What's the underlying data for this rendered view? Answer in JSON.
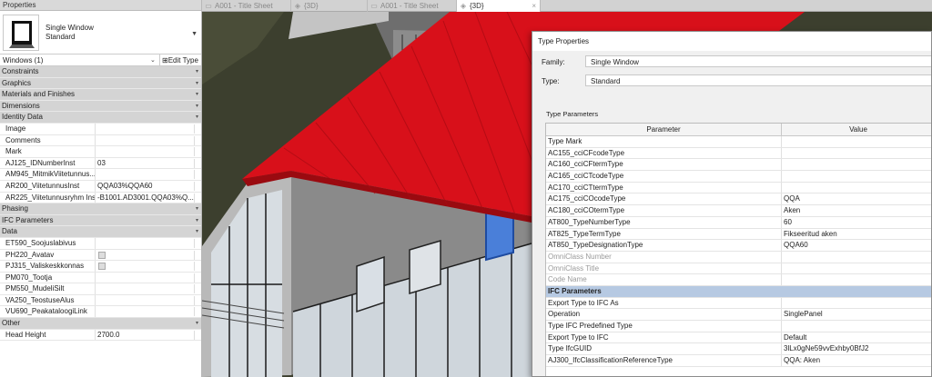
{
  "properties": {
    "panel_title": "Properties",
    "type_name": "Single Window",
    "type_subname": "Standard",
    "filter": "Windows (1)",
    "edit_type_label": "Edit Type",
    "rows": [
      {
        "kind": "section",
        "label": "Constraints"
      },
      {
        "kind": "section",
        "label": "Graphics"
      },
      {
        "kind": "section",
        "label": "Materials and Finishes"
      },
      {
        "kind": "section",
        "label": "Dimensions"
      },
      {
        "kind": "section",
        "label": "Identity Data"
      },
      {
        "kind": "prop",
        "label": "Image",
        "value": ""
      },
      {
        "kind": "prop",
        "label": "Comments",
        "value": ""
      },
      {
        "kind": "prop",
        "label": "Mark",
        "value": ""
      },
      {
        "kind": "prop",
        "label": "AJ125_IDNumberInst",
        "value": "03"
      },
      {
        "kind": "prop",
        "label": "AM945_MitmikViitetunnus...",
        "value": ""
      },
      {
        "kind": "prop",
        "label": "AR200_ViitetunnusInst",
        "value": "QQA03%QQA60"
      },
      {
        "kind": "prop",
        "label": "AR225_Viitetunnusryhm Inst",
        "value": "-B1001.AD3001.QQA03%Q..."
      },
      {
        "kind": "section",
        "label": "Phasing"
      },
      {
        "kind": "section",
        "label": "IFC Parameters"
      },
      {
        "kind": "section",
        "label": "Data"
      },
      {
        "kind": "prop",
        "label": "ET590_Soojuslabivus",
        "value": ""
      },
      {
        "kind": "prop",
        "label": "PH220_Avatav",
        "value": "",
        "checkbox": true
      },
      {
        "kind": "prop",
        "label": "PJ315_Valiskeskkonnas",
        "value": "",
        "checkbox": true
      },
      {
        "kind": "prop",
        "label": "PM070_Tootja",
        "value": ""
      },
      {
        "kind": "prop",
        "label": "PM550_MudeliSilt",
        "value": ""
      },
      {
        "kind": "prop",
        "label": "VA250_TeostuseAlus",
        "value": ""
      },
      {
        "kind": "prop",
        "label": "VU690_PeakataloogiLink",
        "value": ""
      },
      {
        "kind": "section",
        "label": "Other"
      },
      {
        "kind": "prop",
        "label": "Head Height",
        "value": "2700.0"
      }
    ]
  },
  "tabs": [
    {
      "label": "A001 - Title Sheet",
      "icon": "sheet-icon",
      "active": false
    },
    {
      "label": "{3D}",
      "icon": "3d-view-icon",
      "active": false
    },
    {
      "label": "A001 - Title Sheet",
      "icon": "sheet-icon",
      "active": false
    },
    {
      "label": "{3D}",
      "icon": "3d-view-icon",
      "active": true
    }
  ],
  "close_glyph": "×",
  "dialog": {
    "title": "Type Properties",
    "family_label": "Family:",
    "family_value": "Single Window",
    "type_label": "Type:",
    "type_value": "Standard",
    "section_label": "Type Parameters",
    "col_parameter": "Parameter",
    "col_value": "Value",
    "rows": [
      {
        "p": "Type Mark",
        "v": ""
      },
      {
        "p": "AC155_cciCFcodeType",
        "v": ""
      },
      {
        "p": "AC160_cciCFtermType",
        "v": ""
      },
      {
        "p": "AC165_cciCTcodeType",
        "v": ""
      },
      {
        "p": "AC170_cciCTtermType",
        "v": ""
      },
      {
        "p": "AC175_cciCOcodeType",
        "v": "QQA"
      },
      {
        "p": "AC180_cciCOtermType",
        "v": "Aken"
      },
      {
        "p": "AT800_TypeNumberType",
        "v": "60"
      },
      {
        "p": "AT825_TypeTermType",
        "v": "Fikseeritud aken"
      },
      {
        "p": "AT850_TypeDesignationType",
        "v": "QQA60"
      },
      {
        "p": "OmniClass Number",
        "v": "",
        "disabled": true
      },
      {
        "p": "OmniClass Title",
        "v": "",
        "disabled": true
      },
      {
        "p": "Code Name",
        "v": "",
        "disabled": true
      },
      {
        "p": "IFC Parameters",
        "v": "",
        "group": true
      },
      {
        "p": "Export Type to IFC As",
        "v": ""
      },
      {
        "p": "Operation",
        "v": "SinglePanel"
      },
      {
        "p": "Type IFC Predefined Type",
        "v": ""
      },
      {
        "p": "Export Type to IFC",
        "v": "Default"
      },
      {
        "p": "Type IfcGUID",
        "v": "3lLx0gNe59vvExhby0BfJ2"
      },
      {
        "p": "AJ300_IfcClassificationReferenceType",
        "v": "QQA: Aken"
      }
    ]
  },
  "colors": {
    "roof": "#d8101a",
    "terrain": "#3c3f2e",
    "section_header": "#d4d4d4",
    "ifc_group": "#b6c9e2",
    "selected_window": "#4a7fd9"
  }
}
